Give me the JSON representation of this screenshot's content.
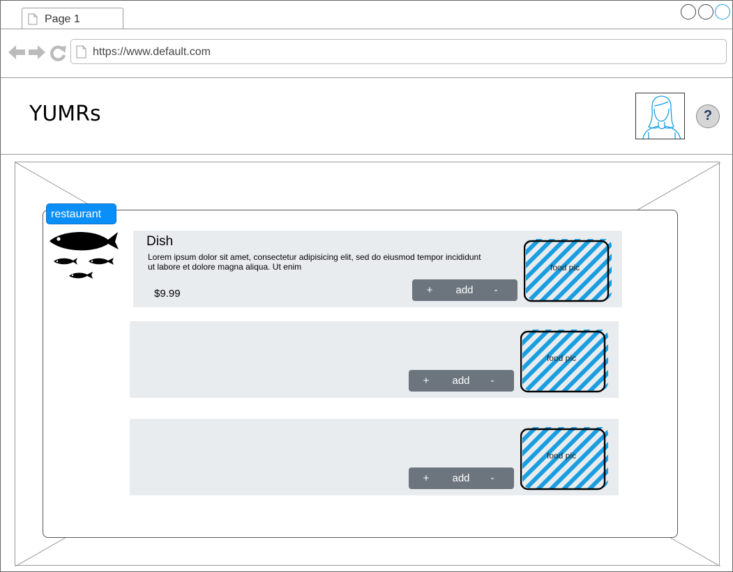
{
  "browser": {
    "tab_label": "Page 1",
    "url": "https://www.default.com"
  },
  "header": {
    "title": "YUMRs",
    "help_label": "?"
  },
  "restaurant": {
    "badge_label": "restaurant",
    "dishes": [
      {
        "name": "Dish",
        "description": "Lorem ipsum dolor sit amet, consectetur adipisicing elit, sed do eiusmod tempor incididunt ut labore et dolore magna aliqua. Ut enim",
        "price": "$9.99",
        "plus_label": "+",
        "add_label": "add",
        "minus_label": "-",
        "pic_label": "food pic"
      },
      {
        "plus_label": "+",
        "add_label": "add",
        "minus_label": "-",
        "pic_label": "food pic"
      },
      {
        "plus_label": "+",
        "add_label": "add",
        "minus_label": "-",
        "pic_label": "food pic"
      }
    ]
  },
  "colors": {
    "badge": "#0a8ef7",
    "button": "#6c757d",
    "dish_bg": "#e9ecef",
    "hatch": "#1a9ee0"
  },
  "icons": {
    "tab": "page-icon",
    "back": "back-arrow-icon",
    "forward": "forward-arrow-icon",
    "reload": "reload-icon",
    "url": "page-icon",
    "avatar": "user-avatar-icon",
    "logo": "fish-logo-icon"
  }
}
